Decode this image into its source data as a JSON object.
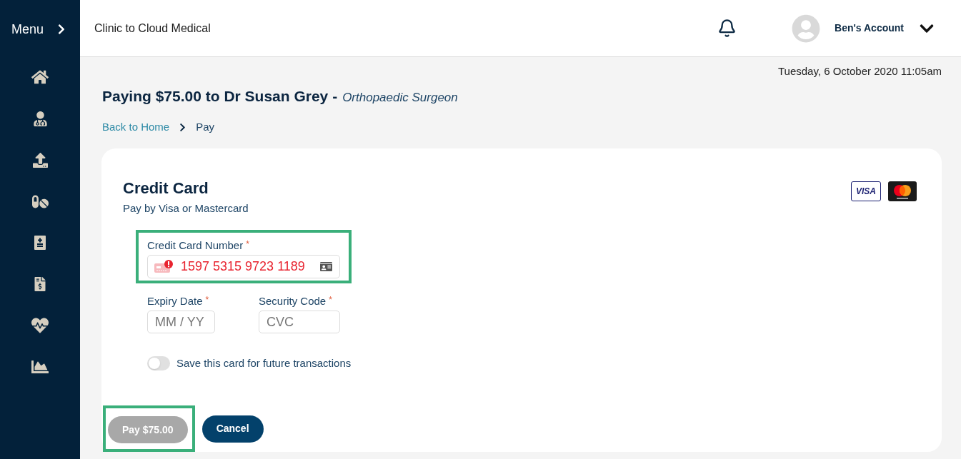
{
  "sidebar": {
    "menu_label": "Menu"
  },
  "header": {
    "app_title": "Clinic to Cloud Medical",
    "account_name": "Ben's Account"
  },
  "datetime": "Tuesday, 6 October 2020 11:05am",
  "page_title": {
    "text": "Paying $75.00 to Dr Susan Grey -",
    "subtitle": "Orthopaedic Surgeon"
  },
  "breadcrumb": [
    {
      "label": "Back to Home",
      "current": false
    },
    {
      "label": "Pay",
      "current": true
    }
  ],
  "payment_card": {
    "title": "Credit Card",
    "subtitle": "Pay by Visa or Mastercard",
    "card_brands": [
      {
        "kind": "visa",
        "text": "VISA"
      },
      {
        "kind": "mastercard"
      }
    ],
    "card_number": {
      "label": "Credit Card Number",
      "required_mark": "*",
      "value": "1597 5315 9723 1189",
      "invalid": true,
      "highlighted": true
    },
    "expiry_date": {
      "label": "Expiry Date",
      "required_mark": "*",
      "placeholder": "MM / YY"
    },
    "security_code": {
      "label": "Security Code",
      "required_mark": "*",
      "placeholder": "CVC"
    },
    "save_card": {
      "label": "Save this card for future transactions",
      "on": false
    },
    "buttons": [
      {
        "label": "Pay $75.00",
        "disabled": true,
        "highlighted": true
      },
      {
        "label": "Cancel",
        "disabled": false,
        "highlighted": false
      }
    ]
  }
}
